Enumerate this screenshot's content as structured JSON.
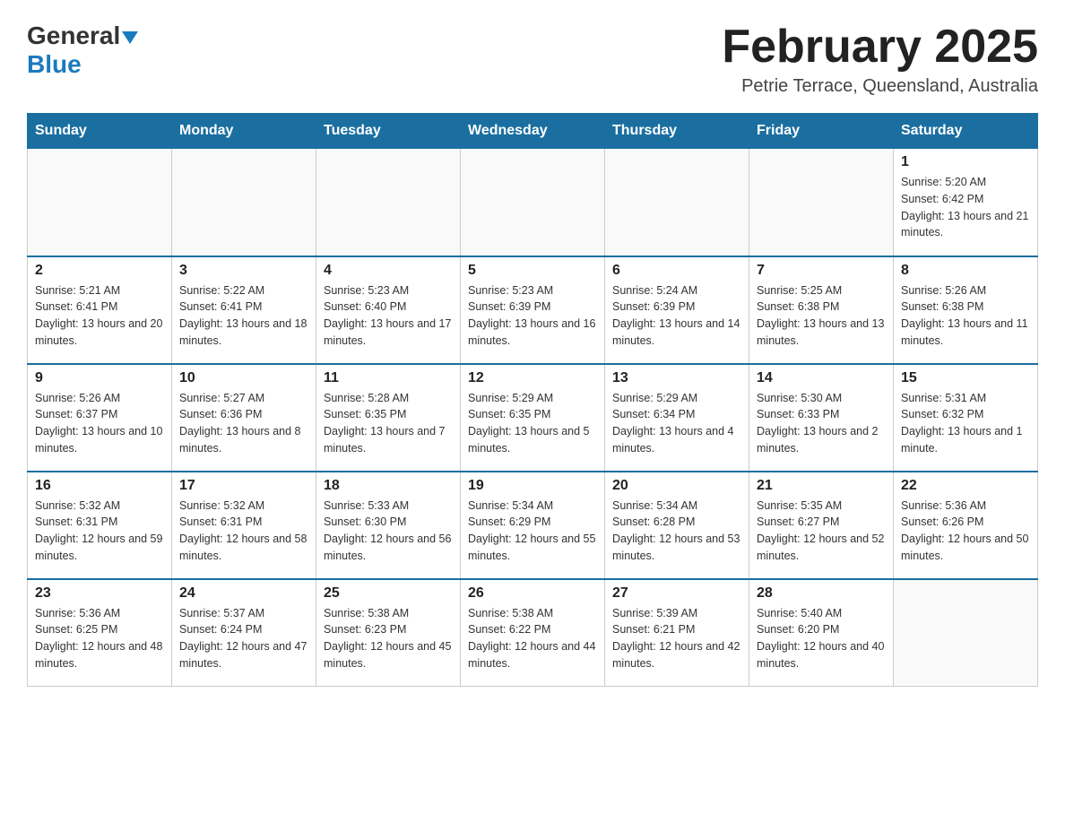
{
  "header": {
    "logo_general": "General",
    "logo_blue": "Blue",
    "month_title": "February 2025",
    "location": "Petrie Terrace, Queensland, Australia"
  },
  "days_of_week": [
    "Sunday",
    "Monday",
    "Tuesday",
    "Wednesday",
    "Thursday",
    "Friday",
    "Saturday"
  ],
  "weeks": [
    [
      {
        "day": "",
        "sunrise": "",
        "sunset": "",
        "daylight": ""
      },
      {
        "day": "",
        "sunrise": "",
        "sunset": "",
        "daylight": ""
      },
      {
        "day": "",
        "sunrise": "",
        "sunset": "",
        "daylight": ""
      },
      {
        "day": "",
        "sunrise": "",
        "sunset": "",
        "daylight": ""
      },
      {
        "day": "",
        "sunrise": "",
        "sunset": "",
        "daylight": ""
      },
      {
        "day": "",
        "sunrise": "",
        "sunset": "",
        "daylight": ""
      },
      {
        "day": "1",
        "sunrise": "Sunrise: 5:20 AM",
        "sunset": "Sunset: 6:42 PM",
        "daylight": "Daylight: 13 hours and 21 minutes."
      }
    ],
    [
      {
        "day": "2",
        "sunrise": "Sunrise: 5:21 AM",
        "sunset": "Sunset: 6:41 PM",
        "daylight": "Daylight: 13 hours and 20 minutes."
      },
      {
        "day": "3",
        "sunrise": "Sunrise: 5:22 AM",
        "sunset": "Sunset: 6:41 PM",
        "daylight": "Daylight: 13 hours and 18 minutes."
      },
      {
        "day": "4",
        "sunrise": "Sunrise: 5:23 AM",
        "sunset": "Sunset: 6:40 PM",
        "daylight": "Daylight: 13 hours and 17 minutes."
      },
      {
        "day": "5",
        "sunrise": "Sunrise: 5:23 AM",
        "sunset": "Sunset: 6:39 PM",
        "daylight": "Daylight: 13 hours and 16 minutes."
      },
      {
        "day": "6",
        "sunrise": "Sunrise: 5:24 AM",
        "sunset": "Sunset: 6:39 PM",
        "daylight": "Daylight: 13 hours and 14 minutes."
      },
      {
        "day": "7",
        "sunrise": "Sunrise: 5:25 AM",
        "sunset": "Sunset: 6:38 PM",
        "daylight": "Daylight: 13 hours and 13 minutes."
      },
      {
        "day": "8",
        "sunrise": "Sunrise: 5:26 AM",
        "sunset": "Sunset: 6:38 PM",
        "daylight": "Daylight: 13 hours and 11 minutes."
      }
    ],
    [
      {
        "day": "9",
        "sunrise": "Sunrise: 5:26 AM",
        "sunset": "Sunset: 6:37 PM",
        "daylight": "Daylight: 13 hours and 10 minutes."
      },
      {
        "day": "10",
        "sunrise": "Sunrise: 5:27 AM",
        "sunset": "Sunset: 6:36 PM",
        "daylight": "Daylight: 13 hours and 8 minutes."
      },
      {
        "day": "11",
        "sunrise": "Sunrise: 5:28 AM",
        "sunset": "Sunset: 6:35 PM",
        "daylight": "Daylight: 13 hours and 7 minutes."
      },
      {
        "day": "12",
        "sunrise": "Sunrise: 5:29 AM",
        "sunset": "Sunset: 6:35 PM",
        "daylight": "Daylight: 13 hours and 5 minutes."
      },
      {
        "day": "13",
        "sunrise": "Sunrise: 5:29 AM",
        "sunset": "Sunset: 6:34 PM",
        "daylight": "Daylight: 13 hours and 4 minutes."
      },
      {
        "day": "14",
        "sunrise": "Sunrise: 5:30 AM",
        "sunset": "Sunset: 6:33 PM",
        "daylight": "Daylight: 13 hours and 2 minutes."
      },
      {
        "day": "15",
        "sunrise": "Sunrise: 5:31 AM",
        "sunset": "Sunset: 6:32 PM",
        "daylight": "Daylight: 13 hours and 1 minute."
      }
    ],
    [
      {
        "day": "16",
        "sunrise": "Sunrise: 5:32 AM",
        "sunset": "Sunset: 6:31 PM",
        "daylight": "Daylight: 12 hours and 59 minutes."
      },
      {
        "day": "17",
        "sunrise": "Sunrise: 5:32 AM",
        "sunset": "Sunset: 6:31 PM",
        "daylight": "Daylight: 12 hours and 58 minutes."
      },
      {
        "day": "18",
        "sunrise": "Sunrise: 5:33 AM",
        "sunset": "Sunset: 6:30 PM",
        "daylight": "Daylight: 12 hours and 56 minutes."
      },
      {
        "day": "19",
        "sunrise": "Sunrise: 5:34 AM",
        "sunset": "Sunset: 6:29 PM",
        "daylight": "Daylight: 12 hours and 55 minutes."
      },
      {
        "day": "20",
        "sunrise": "Sunrise: 5:34 AM",
        "sunset": "Sunset: 6:28 PM",
        "daylight": "Daylight: 12 hours and 53 minutes."
      },
      {
        "day": "21",
        "sunrise": "Sunrise: 5:35 AM",
        "sunset": "Sunset: 6:27 PM",
        "daylight": "Daylight: 12 hours and 52 minutes."
      },
      {
        "day": "22",
        "sunrise": "Sunrise: 5:36 AM",
        "sunset": "Sunset: 6:26 PM",
        "daylight": "Daylight: 12 hours and 50 minutes."
      }
    ],
    [
      {
        "day": "23",
        "sunrise": "Sunrise: 5:36 AM",
        "sunset": "Sunset: 6:25 PM",
        "daylight": "Daylight: 12 hours and 48 minutes."
      },
      {
        "day": "24",
        "sunrise": "Sunrise: 5:37 AM",
        "sunset": "Sunset: 6:24 PM",
        "daylight": "Daylight: 12 hours and 47 minutes."
      },
      {
        "day": "25",
        "sunrise": "Sunrise: 5:38 AM",
        "sunset": "Sunset: 6:23 PM",
        "daylight": "Daylight: 12 hours and 45 minutes."
      },
      {
        "day": "26",
        "sunrise": "Sunrise: 5:38 AM",
        "sunset": "Sunset: 6:22 PM",
        "daylight": "Daylight: 12 hours and 44 minutes."
      },
      {
        "day": "27",
        "sunrise": "Sunrise: 5:39 AM",
        "sunset": "Sunset: 6:21 PM",
        "daylight": "Daylight: 12 hours and 42 minutes."
      },
      {
        "day": "28",
        "sunrise": "Sunrise: 5:40 AM",
        "sunset": "Sunset: 6:20 PM",
        "daylight": "Daylight: 12 hours and 40 minutes."
      },
      {
        "day": "",
        "sunrise": "",
        "sunset": "",
        "daylight": ""
      }
    ]
  ]
}
